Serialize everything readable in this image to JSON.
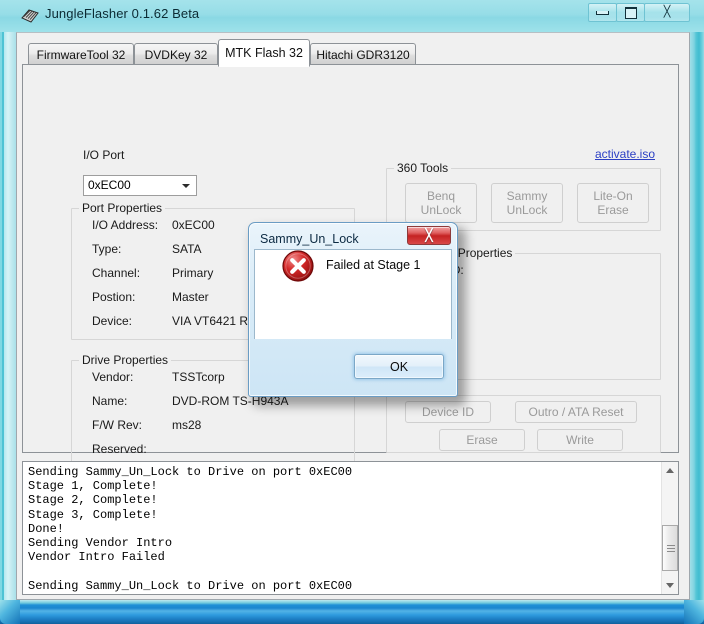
{
  "window": {
    "title": "JungleFlasher 0.1.62 Beta",
    "icon": "chip-icon",
    "caption": {
      "minimize": "minimize-button",
      "maximize": "maximize-button",
      "close": "close-button",
      "close_glyph": "╳"
    }
  },
  "tabs": [
    {
      "label": "FirmwareTool 32",
      "selected": false
    },
    {
      "label": "DVDKey 32",
      "selected": false
    },
    {
      "label": "MTK Flash 32",
      "selected": true
    },
    {
      "label": "Hitachi GDR3120",
      "selected": false
    }
  ],
  "page": {
    "io_port": {
      "label": "I/O Port",
      "value": "0xEC00",
      "options": [
        "0xEC00"
      ]
    },
    "iso_link": "activate.iso",
    "port_properties": {
      "legend": "Port Properties",
      "rows": [
        {
          "label": "I/O Address:",
          "value": "0xEC00"
        },
        {
          "label": "Type:",
          "value": "SATA"
        },
        {
          "label": "Channel:",
          "value": "Primary"
        },
        {
          "label": "Postion:",
          "value": "Master"
        },
        {
          "label": "Device:",
          "value": "VIA VT6421 RAID Controller"
        }
      ]
    },
    "drive_properties": {
      "legend": "Drive Properties",
      "rows": [
        {
          "label": "Vendor:",
          "value": "TSSTcorp"
        },
        {
          "label": "Name:",
          "value": "DVD-ROM TS-H943A"
        },
        {
          "label": "F/W Rev:",
          "value": "ms28"
        },
        {
          "label": "Reserved:",
          "value": ""
        }
      ]
    },
    "tools_360": {
      "legend": "360 Tools",
      "buttons": [
        {
          "label": "Benq\nUnLock",
          "enabled": false
        },
        {
          "label": "Sammy\nUnLock",
          "enabled": false
        },
        {
          "label": "Lite-On Erase",
          "enabled": false
        }
      ]
    },
    "flash_chip_properties": {
      "legend": "Flash Chip Properties",
      "rows": [
        {
          "label": "Vendor ID:",
          "value": ""
        }
      ]
    },
    "flash_buttons": [
      {
        "label": "Device ID",
        "enabled": false
      },
      {
        "label": "Outro / ATA Reset",
        "enabled": false
      },
      {
        "label": "Erase",
        "enabled": false
      },
      {
        "label": "Write",
        "enabled": false
      }
    ]
  },
  "log": {
    "text": "Sending Sammy_Un_Lock to Drive on port 0xEC00\nStage 1, Complete!\nStage 2, Complete!\nStage 3, Complete!\nDone!\nSending Vendor Intro\nVendor Intro Failed\n\nSending Sammy_Un_Lock to Drive on port 0xEC00",
    "scrollbar": {
      "up_arrow": "scroll-up-arrow",
      "down_arrow": "scroll-down-arrow"
    }
  },
  "dialog": {
    "title": "Sammy_Un_Lock",
    "message": "Failed at Stage 1",
    "icon": "error-icon",
    "ok_label": "OK",
    "close_glyph": "╳"
  },
  "colors": {
    "accent": "#8ad8e4",
    "link": "#2b3fc4",
    "error": "#c52222",
    "frame_bottom": "#1d7ec4"
  }
}
